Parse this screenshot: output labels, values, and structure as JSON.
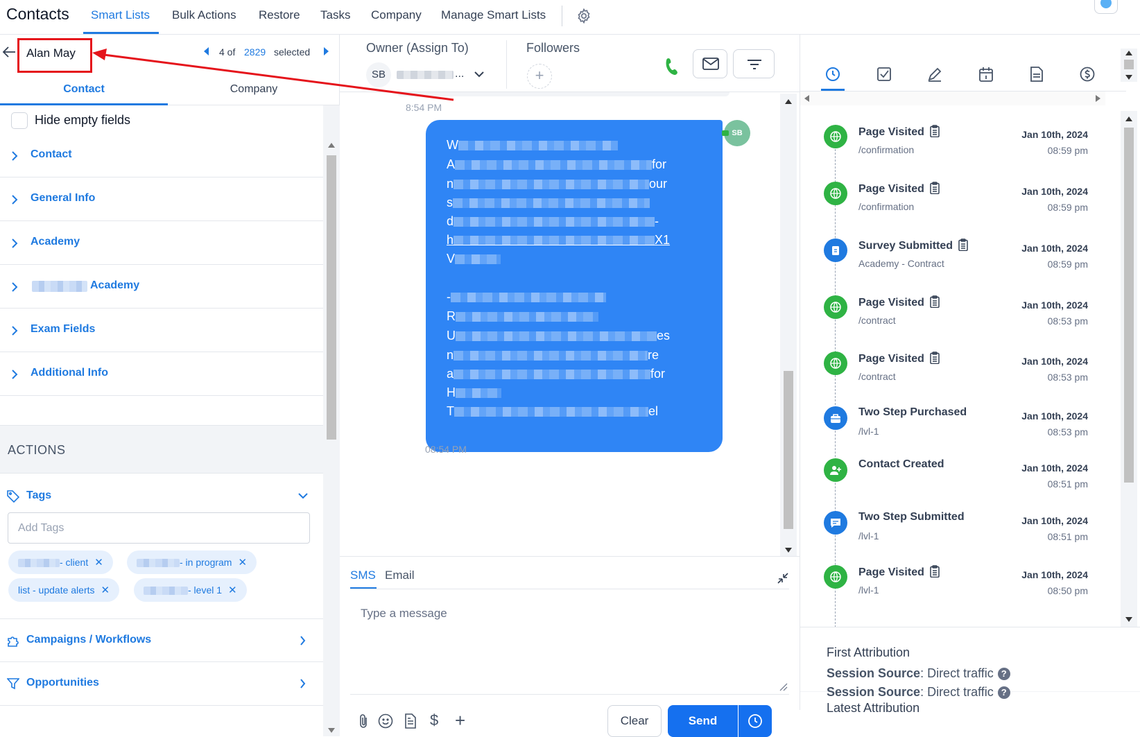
{
  "topnav": {
    "title": "Contacts",
    "tabs": [
      "Smart Lists",
      "Bulk Actions",
      "Restore",
      "Tasks",
      "Company",
      "Manage Smart Lists"
    ],
    "active_tab": "Smart Lists"
  },
  "contact_header": {
    "name": "Alan May",
    "position_prefix": "4 of",
    "total": "2829",
    "selected_label": "selected"
  },
  "left_tabs": {
    "contact": "Contact",
    "company": "Company"
  },
  "hide_empty_label": "Hide empty fields",
  "field_sections": [
    "Contact",
    "General Info",
    "Academy",
    "Academy",
    "Exam Fields",
    "Additional Info"
  ],
  "actions": {
    "heading": "ACTIONS",
    "tags_label": "Tags",
    "tags_placeholder": "Add Tags",
    "tags": [
      "- client",
      "- in program",
      "list - update alerts",
      "- level 1"
    ],
    "campaigns_label": "Campaigns / Workflows",
    "opportunities_label": "Opportunities"
  },
  "conversation_header": {
    "owner_label": "Owner (Assign To)",
    "owner_initials": "SB",
    "owner_name_suffix": "...",
    "followers_label": "Followers"
  },
  "messages": {
    "time_above": "8:54 PM",
    "time_below": "08:54 PM",
    "sender_initials": "SB",
    "lines": [
      {
        "start": "W",
        "end": ""
      },
      {
        "start": "A",
        "end": "for"
      },
      {
        "start": "n",
        "end": "our"
      },
      {
        "start": "s",
        "end": ""
      },
      {
        "start": "d",
        "end": "-"
      },
      {
        "start": "h",
        "end": "X1"
      },
      {
        "start": "V",
        "end": ""
      },
      {
        "start": "",
        "end": ""
      },
      {
        "start": "-",
        "end": ""
      },
      {
        "start": "R",
        "end": ""
      },
      {
        "start": "U",
        "end": "es"
      },
      {
        "start": "n",
        "end": "re"
      },
      {
        "start": "a",
        "end": "for"
      },
      {
        "start": "H",
        "end": ""
      },
      {
        "start": "T",
        "end": "el"
      }
    ]
  },
  "composer": {
    "tabs": [
      "SMS",
      "Email"
    ],
    "active_tab": "SMS",
    "placeholder": "Type a message",
    "clear_label": "Clear",
    "send_label": "Send"
  },
  "activity": [
    {
      "title": "Page Visited",
      "sub": "/confirmation",
      "date": "Jan 10th, 2024",
      "time": "08:59 pm",
      "icon": "globe-icon",
      "color": "#2fb344",
      "clip": true
    },
    {
      "title": "Page Visited",
      "sub": "/confirmation",
      "date": "Jan 10th, 2024",
      "time": "08:59 pm",
      "icon": "globe-icon",
      "color": "#2fb344",
      "clip": true
    },
    {
      "title": "Survey Submitted",
      "sub": "Academy - Contract",
      "date": "Jan 10th, 2024",
      "time": "08:59 pm",
      "icon": "clipboard-icon",
      "color": "#1f7ae0",
      "clip": true
    },
    {
      "title": "Page Visited",
      "sub": "/contract",
      "date": "Jan 10th, 2024",
      "time": "08:53 pm",
      "icon": "globe-icon",
      "color": "#2fb344",
      "clip": true
    },
    {
      "title": "Page Visited",
      "sub": "/contract",
      "date": "Jan 10th, 2024",
      "time": "08:53 pm",
      "icon": "globe-icon",
      "color": "#2fb344",
      "clip": true
    },
    {
      "title": "Two Step Purchased",
      "sub": "/lvl-1",
      "date": "Jan 10th, 2024",
      "time": "08:53 pm",
      "icon": "briefcase-icon",
      "color": "#1f7ae0",
      "clip": false
    },
    {
      "title": "Contact Created",
      "sub": "",
      "date": "Jan 10th, 2024",
      "time": "08:51 pm",
      "icon": "user-plus-icon",
      "color": "#2fb344",
      "clip": false
    },
    {
      "title": "Two Step Submitted",
      "sub": "/lvl-1",
      "date": "Jan 10th, 2024",
      "time": "08:51 pm",
      "icon": "message-icon",
      "color": "#1f7ae0",
      "clip": false
    },
    {
      "title": "Page Visited",
      "sub": "/lvl-1",
      "date": "Jan 10th, 2024",
      "time": "08:50 pm",
      "icon": "globe-icon",
      "color": "#2fb344",
      "clip": true
    }
  ],
  "attribution": {
    "first_label": "First Attribution",
    "first_source_key": "Session Source",
    "first_source_value": ": Direct traffic",
    "latest_label": "Latest Attribution",
    "latest_source_key": "Session Source",
    "latest_source_value": ": Direct traffic"
  },
  "colors": {
    "accent": "#1f7ae0",
    "bubble": "#2f85f5",
    "green": "#2fb344",
    "annotation": "#e5141b"
  }
}
